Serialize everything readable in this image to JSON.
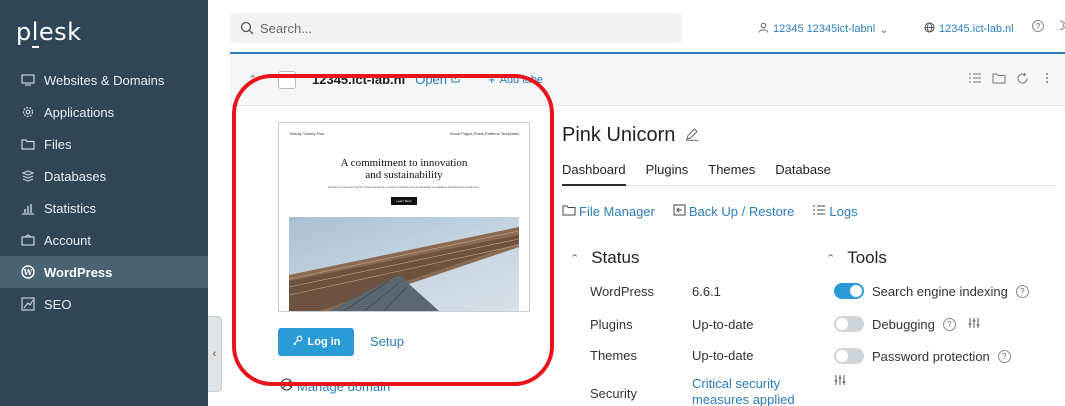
{
  "brand": {
    "name_a": "p",
    "name_b": "l",
    "name_c": "esk"
  },
  "sidebar": {
    "items": [
      {
        "label": "Websites & Domains",
        "icon": "monitor-icon"
      },
      {
        "label": "Applications",
        "icon": "gear-icon"
      },
      {
        "label": "Files",
        "icon": "folder-icon"
      },
      {
        "label": "Databases",
        "icon": "database-icon"
      },
      {
        "label": "Statistics",
        "icon": "bar-chart-icon"
      },
      {
        "label": "Account",
        "icon": "account-icon"
      },
      {
        "label": "WordPress",
        "icon": "wordpress-icon",
        "active": true
      },
      {
        "label": "SEO",
        "icon": "seo-icon"
      }
    ],
    "collapse_glyph": "‹"
  },
  "topbar": {
    "search_placeholder": "Search...",
    "user": "12345 12345ict-labnl",
    "user_caret": "⌄",
    "domain": "12345.ict-lab.nl",
    "help": "?",
    "moon": "☽"
  },
  "card": {
    "chevron": "⌃",
    "domain": "12345.ict-lab.nl",
    "open_label": "Open",
    "add_label": "Add labe",
    "thumbnail": {
      "nav_left": "Twenty Twenty-Five",
      "nav_right": "Home  Pages  Posts  Patterns  Templates",
      "headline_1": "A commitment to innovation",
      "headline_2": "and sustainability",
      "subtext": "Études is a pioneering firm that seamlessly merges creativity and functionality to redefine architectural excellence.",
      "button": "Learn More"
    },
    "login_label": "Log in",
    "setup_label": "Setup",
    "manage_domain_label": "Manage domain"
  },
  "site": {
    "title": "Pink Unicorn",
    "tabs": [
      "Dashboard",
      "Plugins",
      "Themes",
      "Database"
    ],
    "active_tab": "Dashboard",
    "actions": [
      {
        "label": "File Manager",
        "icon": "folder-icon"
      },
      {
        "label": "Back Up / Restore",
        "icon": "backup-icon"
      },
      {
        "label": "Logs",
        "icon": "list-icon"
      }
    ]
  },
  "status": {
    "title": "Status",
    "rows": [
      {
        "label": "WordPress",
        "value": "6.6.1"
      },
      {
        "label": "Plugins",
        "value": "Up-to-date"
      },
      {
        "label": "Themes",
        "value": "Up-to-date"
      },
      {
        "label": "Security",
        "value_line1": "Critical security",
        "value_line2": "measures applied"
      }
    ]
  },
  "tools": {
    "title": "Tools",
    "rows": [
      {
        "label": "Search engine indexing",
        "on": true
      },
      {
        "label": "Debugging",
        "on": false
      },
      {
        "label": "Password protection",
        "on": false
      }
    ]
  },
  "colors": {
    "sidebar_bg": "#2e4656",
    "accent": "#2b9bd6",
    "link": "#2b7dbc",
    "highlight": "#e8141c"
  }
}
